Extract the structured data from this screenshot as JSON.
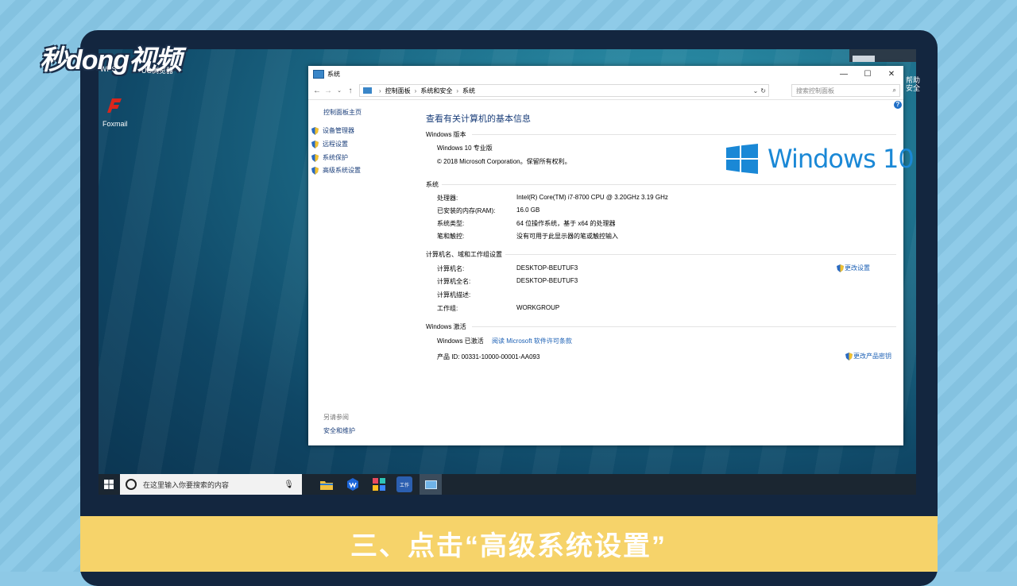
{
  "watermark": {
    "logo_text": "秒dong视频"
  },
  "desktop": {
    "icons": [
      {
        "label": "WPS"
      },
      {
        "label": "UC浏览器"
      },
      {
        "label": "Foxmail"
      }
    ],
    "right_labels": [
      "帮助",
      "安全"
    ]
  },
  "window": {
    "title": "系统",
    "buttons": {
      "minimize": "—",
      "maximize": "☐",
      "close": "✕"
    },
    "breadcrumb": [
      "控制面板",
      "系统和安全",
      "系统"
    ],
    "search_placeholder": "搜索控制面板",
    "sidebar": {
      "home": "控制面板主页",
      "items": [
        "设备管理器",
        "远程设置",
        "系统保护",
        "高级系统设置"
      ],
      "see_also": "另请参阅",
      "see_also_items": [
        "安全和维护"
      ]
    },
    "main": {
      "headline": "查看有关计算机的基本信息",
      "edition_section": {
        "title": "Windows 版本",
        "edition": "Windows 10 专业版",
        "copyright": "© 2018 Microsoft Corporation。保留所有权利。"
      },
      "logo_text": "Windows 10",
      "system_section": {
        "title": "系统",
        "rows": [
          {
            "label": "处理器:",
            "value": "Intel(R) Core(TM) i7-8700 CPU @ 3.20GHz   3.19 GHz"
          },
          {
            "label": "已安装的内存(RAM):",
            "value": "16.0 GB"
          },
          {
            "label": "系统类型:",
            "value": "64 位操作系统，基于 x64 的处理器"
          },
          {
            "label": "笔和触控:",
            "value": "没有可用于此显示器的笔或触控输入"
          }
        ]
      },
      "computer_section": {
        "title": "计算机名、域和工作组设置",
        "rows": [
          {
            "label": "计算机名:",
            "value": "DESKTOP-BEUTUF3"
          },
          {
            "label": "计算机全名:",
            "value": "DESKTOP-BEUTUF3"
          },
          {
            "label": "计算机描述:",
            "value": ""
          },
          {
            "label": "工作组:",
            "value": "WORKGROUP"
          }
        ],
        "change_settings": "更改设置"
      },
      "activation_section": {
        "title": "Windows 激活",
        "status": "Windows 已激活",
        "license_link": "阅读 Microsoft 软件许可条款",
        "product_id": "产品 ID: 00331-10000-00001-AA093",
        "change_key": "更改产品密钥"
      }
    }
  },
  "taskbar": {
    "search_placeholder": "在这里输入你要搜索的内容",
    "apps": [
      "文件资源管理器",
      "WPS",
      "应用",
      "工作",
      "系统"
    ],
    "work_label": "工作"
  },
  "caption": {
    "text": "三、点击“高级系统设置”"
  },
  "colors": {
    "link": "#1a5fb4",
    "caption_band": "#f6d36a",
    "win10_blue": "#1a88d6"
  }
}
